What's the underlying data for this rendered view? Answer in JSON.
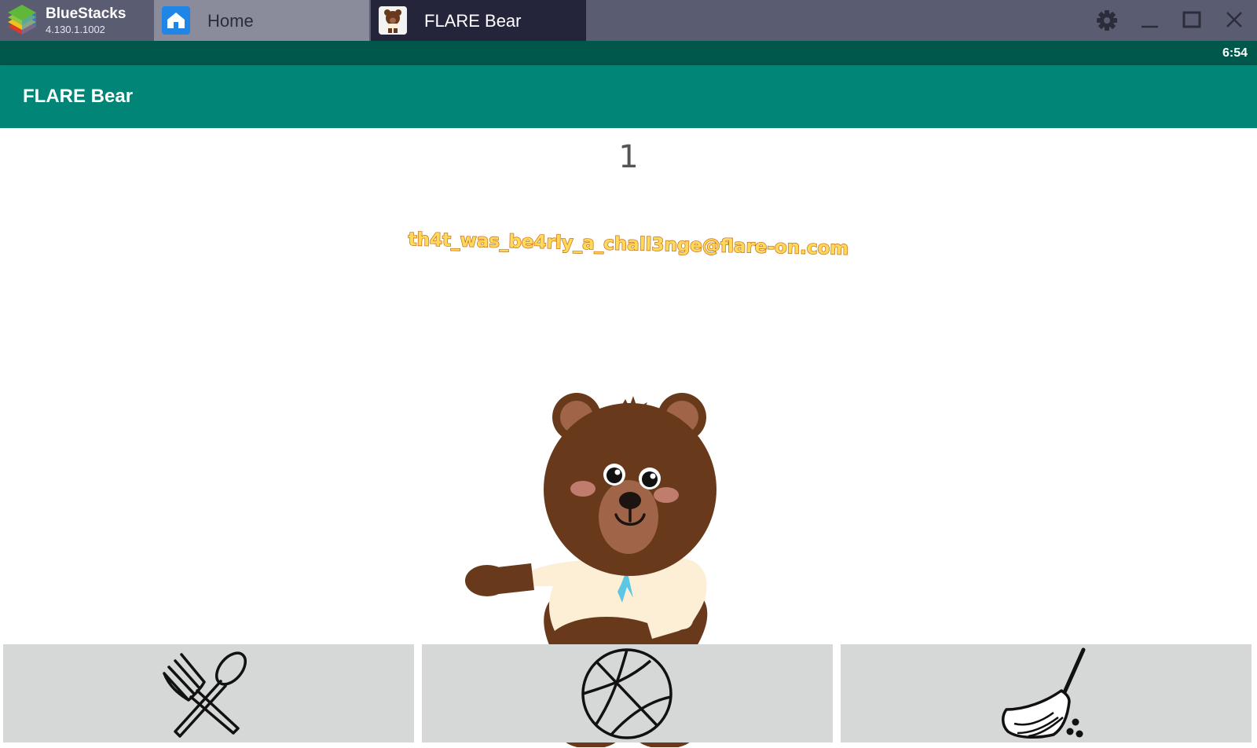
{
  "bluestacks": {
    "name": "BlueStacks",
    "version": "4.130.1.1002"
  },
  "tabs": [
    {
      "label": "Home",
      "icon": "home-icon",
      "active": false
    },
    {
      "label": "FLARE Bear",
      "icon": "bear-app-icon",
      "active": true
    }
  ],
  "window_controls": [
    "gear-icon",
    "minimize-icon",
    "maximize-icon",
    "close-icon"
  ],
  "status_bar": {
    "time": "6:54"
  },
  "app_bar": {
    "title": "FLARE Bear"
  },
  "main": {
    "counter": "1",
    "flag": "th4t_was_be4rly_a_chall3nge@flare-on.com",
    "character": "bear"
  },
  "actions": [
    {
      "name": "feed",
      "icon": "fork-spoon-icon"
    },
    {
      "name": "play",
      "icon": "basketball-icon"
    },
    {
      "name": "clean",
      "icon": "broom-icon"
    }
  ],
  "colors": {
    "titlebar": "#5a5c71",
    "tab_active": "#24243a",
    "status_bar": "#00574b",
    "app_bar": "#008577",
    "button_bg": "#d6d7d7",
    "bear_fur": "#68391a",
    "bear_muzzle": "#a06548",
    "shirt": "#fdeed6",
    "logo_blue": "#5cc7e4",
    "flag_fill": "#ffd95a",
    "flag_outline": "#c86a14"
  }
}
